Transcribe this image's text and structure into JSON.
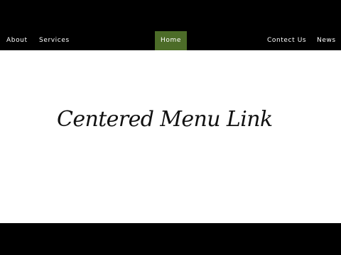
{
  "nav": {
    "items": [
      {
        "label": "About"
      },
      {
        "label": "Services"
      },
      {
        "label": "Home"
      },
      {
        "label": "Contect Us"
      },
      {
        "label": "News"
      }
    ],
    "active_label": "Home"
  },
  "content": {
    "headline": "Centered Menu Link"
  },
  "colors": {
    "nav_background": "#000000",
    "nav_text": "#ffffff",
    "active_background": "#4c6c28",
    "content_background": "#ffffff",
    "headline_text": "#111111"
  }
}
